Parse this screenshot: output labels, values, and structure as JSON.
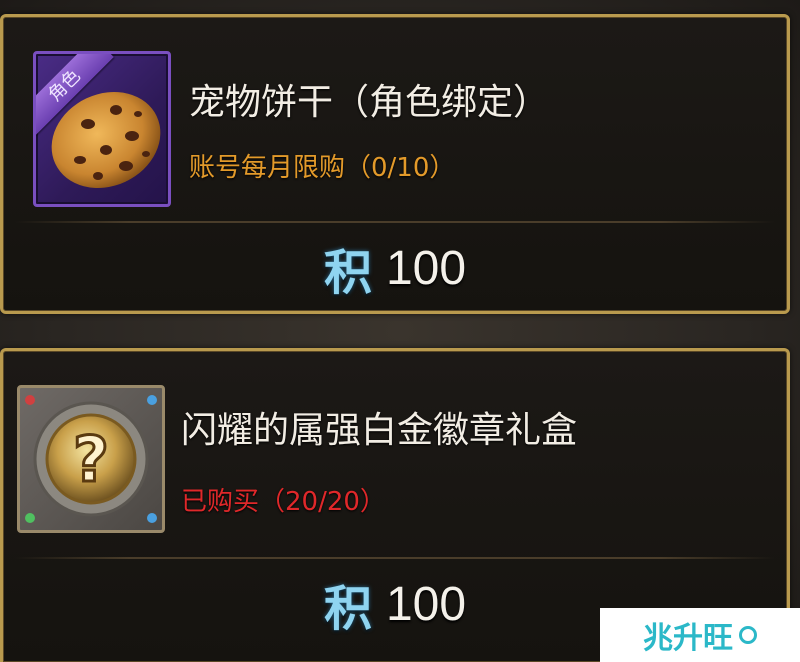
{
  "items": [
    {
      "ribbon": "角色",
      "title": "宠物饼干（角色绑定）",
      "limit": "账号每月限购（0/10）",
      "limit_color": "#e39a2a",
      "frame_color": "#7a4fc0",
      "icon": "cookie-icon",
      "currency": "积",
      "price": "100"
    },
    {
      "title": "闪耀的属强白金徽章礼盒",
      "limit": "已购买（20/20）",
      "limit_color": "#e0282a",
      "frame_color": "#9a8a6a",
      "icon": "mystery-box-icon",
      "currency": "积",
      "price": "100"
    }
  ],
  "watermark": "兆升旺"
}
